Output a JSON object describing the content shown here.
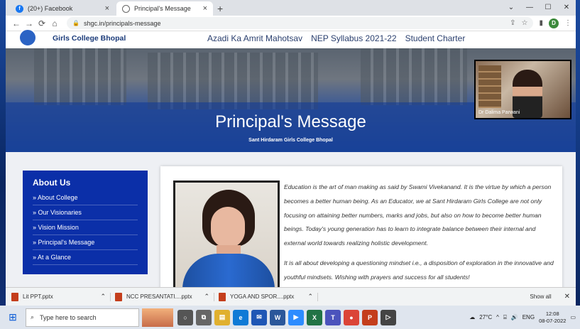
{
  "browser": {
    "tabs": [
      {
        "label": "(20+) Facebook",
        "icon": "facebook-icon"
      },
      {
        "label": "Principal's Message",
        "icon": "globe-icon"
      }
    ],
    "url": "shgc.in/principals-message",
    "profile_initial": "D"
  },
  "site": {
    "brand": "Girls College Bhopal",
    "nav": [
      "Azadi Ka Amrit Mahotsav",
      "NEP Syllabus 2021-22",
      "Student Charter"
    ],
    "hero_title": "Principal's Message",
    "hero_subtitle": "Sant Hirdaram Girls College Bhopal",
    "video_name": "Dr Dalima Parwani"
  },
  "sidebar": {
    "title": "About Us",
    "items": [
      "» About College",
      "» Our Visionaries",
      "» Vision Mission",
      "» Principal's Message",
      "» At a Glance"
    ]
  },
  "message": {
    "p1": "Education is the art of man making as said by Swami Vivekanand. It is the virtue by which a person becomes a better human being. As an Educator, we at Sant Hirdaram Girls College are not only focusing on attaining better numbers, marks and jobs, but also on how to become better human beings. Today's young generation has to learn to integrate balance between their internal and external world towards realizing holistic development.",
    "p2": "It is all about developing a questioning mindset i.e., a disposition of exploration in the innovative and youthful mindsets. Wishing with prayers and success for all students!"
  },
  "downloads": {
    "files": [
      "Lit PPT.pptx",
      "NCC PRESANTATI....pptx",
      "YOGA AND SPOR....pptx"
    ],
    "show_all": "Show all"
  },
  "taskbar": {
    "search_placeholder": "Type here to search",
    "weather": "27°C",
    "lang": "ENG",
    "time": "12:08",
    "date": "08-07-2022"
  },
  "colors": {
    "sidebar_bg": "#0b2fa8",
    "brand_blue": "#1b3b7a"
  }
}
